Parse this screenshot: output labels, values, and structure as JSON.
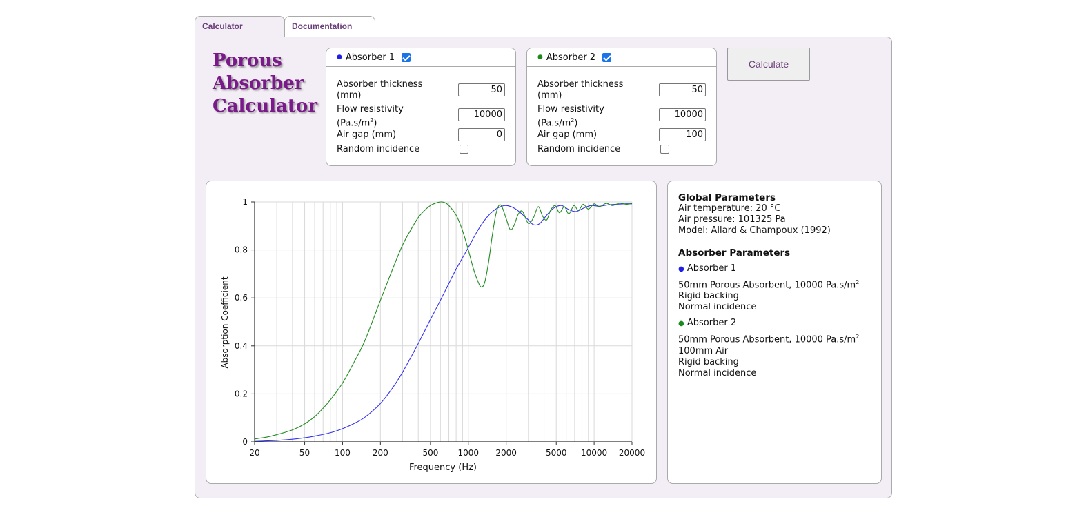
{
  "tabs": [
    {
      "label": "Calculator",
      "active": true
    },
    {
      "label": "Documentation",
      "active": false
    }
  ],
  "app_title": "Porous Absorber Calculator",
  "absorbers": [
    {
      "name": "Absorber 1",
      "color": "#1f1fe8",
      "enabled": true,
      "thickness_label": "Absorber thickness (mm)",
      "thickness": "50",
      "flow_label": "Flow resistivity",
      "flow_unit_prefix": "(Pa.s/m",
      "flow_unit_sup": "2",
      "flow_unit_suffix": ")",
      "flow": "10000",
      "airgap_label": "Air gap (mm)",
      "airgap": "0",
      "random_label": "Random incidence",
      "random_incidence": false
    },
    {
      "name": "Absorber 2",
      "color": "#1a8a1a",
      "enabled": true,
      "thickness_label": "Absorber thickness (mm)",
      "thickness": "50",
      "flow_label": "Flow resistivity",
      "flow_unit_prefix": "(Pa.s/m",
      "flow_unit_sup": "2",
      "flow_unit_suffix": ")",
      "flow": "10000",
      "airgap_label": "Air gap (mm)",
      "airgap": "100",
      "random_label": "Random incidence",
      "random_incidence": false
    }
  ],
  "calculate_label": "Calculate",
  "info": {
    "global_title": "Global Parameters",
    "global_lines": [
      "Air temperature: 20 °C",
      "Air pressure: 101325 Pa",
      "Model: Allard & Champoux (1992)"
    ],
    "absorber_title": "Absorber Parameters",
    "absorbers": [
      {
        "name": "Absorber 1",
        "color": "#1f1fe8",
        "desc_prefix": "50mm Porous Absorbent, 10000 Pa.s/m",
        "desc_sup": "2",
        "lines": [
          "Rigid backing",
          "Normal incidence"
        ]
      },
      {
        "name": "Absorber 2",
        "color": "#1a8a1a",
        "desc_prefix": "50mm Porous Absorbent, 10000 Pa.s/m",
        "desc_sup": "2",
        "lines": [
          "100mm Air",
          "Rigid backing",
          "Normal incidence"
        ]
      }
    ]
  },
  "chart_data": {
    "type": "line",
    "xlabel": "Frequency (Hz)",
    "ylabel": "Absorption Coefficient",
    "xscale": "log",
    "xlim": [
      20,
      20000
    ],
    "ylim": [
      0,
      1
    ],
    "grid": true,
    "legend": "none",
    "x_ticks": [
      20,
      50,
      100,
      200,
      500,
      1000,
      2000,
      5000,
      10000,
      20000
    ],
    "y_ticks": [
      "0",
      "0.2",
      "0.4",
      "0.6",
      "0.8",
      "1"
    ],
    "series": [
      {
        "color": "#3333ee",
        "x": [
          20,
          25,
          30,
          40,
          50,
          60,
          80,
          100,
          125,
          150,
          200,
          250,
          300,
          400,
          500,
          600,
          700,
          800,
          1000,
          1200,
          1400,
          1600,
          1800,
          2000,
          2300,
          2600,
          3000,
          3300,
          3700,
          4200,
          4800,
          5500,
          6300,
          7200,
          8300,
          9500,
          11000,
          13000,
          15000,
          17500,
          20000
        ],
        "y": [
          0.002,
          0.004,
          0.006,
          0.011,
          0.017,
          0.024,
          0.038,
          0.055,
          0.078,
          0.102,
          0.16,
          0.225,
          0.29,
          0.41,
          0.51,
          0.59,
          0.66,
          0.72,
          0.81,
          0.885,
          0.935,
          0.965,
          0.98,
          0.985,
          0.975,
          0.955,
          0.925,
          0.905,
          0.91,
          0.945,
          0.975,
          0.985,
          0.968,
          0.96,
          0.975,
          0.985,
          0.982,
          0.988,
          0.99,
          0.992,
          0.992
        ]
      },
      {
        "color": "#228b22",
        "x": [
          20,
          25,
          30,
          40,
          50,
          60,
          70,
          80,
          100,
          120,
          150,
          200,
          250,
          300,
          350,
          400,
          450,
          500,
          550,
          600,
          650,
          700,
          800,
          900,
          1000,
          1100,
          1200,
          1270,
          1350,
          1450,
          1550,
          1650,
          1750,
          1850,
          2000,
          2150,
          2300,
          2500,
          2700,
          3000,
          3300,
          3600,
          3900,
          4200,
          4500,
          4900,
          5300,
          5800,
          6300,
          6900,
          7500,
          8200,
          9000,
          10000,
          11000,
          12500,
          14000,
          16000,
          18000,
          20000
        ],
        "y": [
          0.012,
          0.02,
          0.03,
          0.05,
          0.075,
          0.105,
          0.14,
          0.175,
          0.245,
          0.32,
          0.42,
          0.59,
          0.72,
          0.82,
          0.885,
          0.935,
          0.965,
          0.985,
          0.995,
          1.0,
          0.997,
          0.985,
          0.945,
          0.88,
          0.8,
          0.72,
          0.665,
          0.645,
          0.665,
          0.75,
          0.86,
          0.945,
          0.985,
          0.98,
          0.93,
          0.885,
          0.9,
          0.95,
          0.96,
          0.91,
          0.935,
          0.98,
          0.94,
          0.925,
          0.965,
          0.985,
          0.955,
          0.98,
          0.95,
          0.985,
          0.965,
          0.99,
          0.97,
          0.992,
          0.98,
          0.994,
          0.985,
          0.995,
          0.99,
          0.995
        ]
      }
    ]
  }
}
